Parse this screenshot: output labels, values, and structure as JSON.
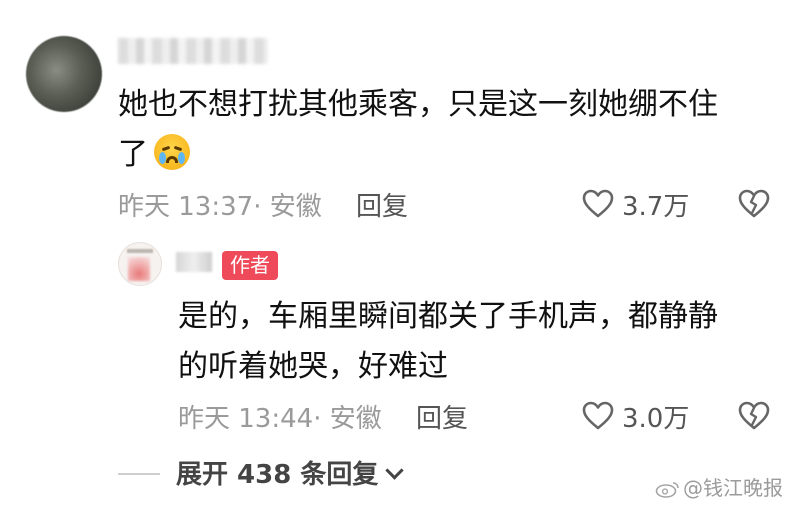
{
  "comment": {
    "text_line1": "她也不想打扰其他乘客，只是这一刻她绷不住",
    "text_line2": "了",
    "emoji_icon": "crying-face-emoji",
    "time": "昨天 13:37",
    "location": "安徽",
    "reply_label": "回复",
    "like_count": "3.7万"
  },
  "reply": {
    "author_badge": "作者",
    "text_line1": "是的，车厢里瞬间都关了手机声，都静静",
    "text_line2": "的听着她哭，好难过",
    "time": "昨天 13:44",
    "location": "安徽",
    "reply_label": "回复",
    "like_count": "3.0万"
  },
  "expand_replies": "展开 438 条回复",
  "watermark": "@钱江晚报",
  "colors": {
    "badge": "#ef4a5a",
    "meta_text": "#9a9a9a",
    "body_text": "#111111"
  }
}
